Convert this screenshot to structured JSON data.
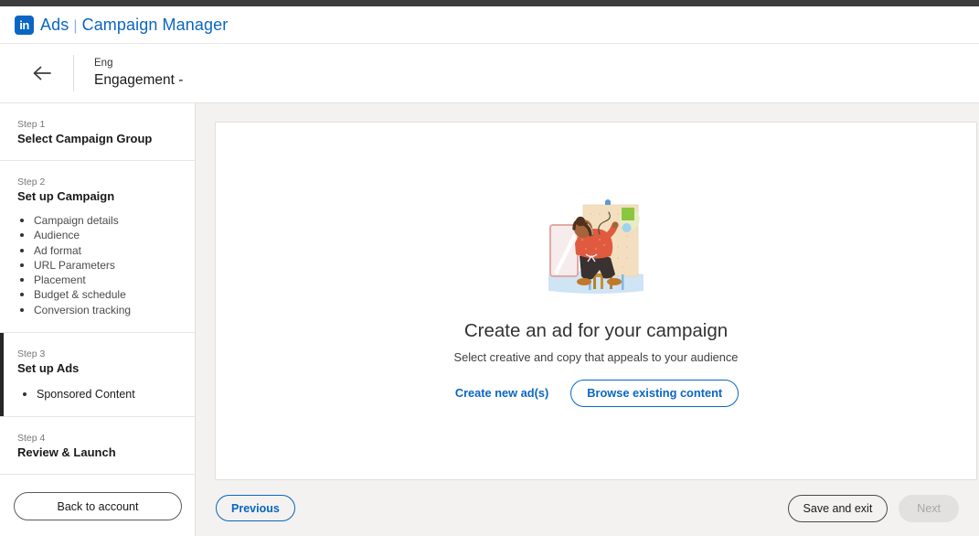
{
  "header": {
    "logo_glyph": "in",
    "brand_primary": "Ads",
    "brand_separator": "|",
    "brand_secondary": "Campaign Manager"
  },
  "sub_header": {
    "back_icon": "arrow-left-icon",
    "breadcrumb_small": "Eng",
    "breadcrumb_large": "Engagement -"
  },
  "sidebar": {
    "steps": [
      {
        "eyebrow": "Step 1",
        "title": "Select Campaign Group",
        "active": false,
        "items": []
      },
      {
        "eyebrow": "Step 2",
        "title": "Set up Campaign",
        "active": false,
        "items": [
          "Campaign details",
          "Audience",
          "Ad format",
          "URL Parameters",
          "Placement",
          "Budget & schedule",
          "Conversion tracking"
        ]
      },
      {
        "eyebrow": "Step 3",
        "title": "Set up Ads",
        "active": true,
        "items": [
          "Sponsored Content"
        ]
      },
      {
        "eyebrow": "Step 4",
        "title": "Review & Launch",
        "active": false,
        "items": []
      }
    ],
    "back_to_account_label": "Back to account"
  },
  "main": {
    "illustration_name": "person-drawing-on-easel-illustration",
    "empty_title": "Create an ad for your campaign",
    "empty_subtitle": "Select creative and copy that appeals to your audience",
    "create_new_label": "Create new ad(s)",
    "browse_existing_label": "Browse existing content"
  },
  "action_bar": {
    "previous_label": "Previous",
    "save_and_exit_label": "Save and exit",
    "next_label": "Next",
    "next_disabled": true
  },
  "colors": {
    "linkedin_blue": "#0a66c2",
    "page_bg": "#f3f2f0",
    "active_step_bar": "#262626",
    "disabled_btn_bg": "#e2e1df",
    "disabled_btn_text": "#a8a7a5"
  }
}
